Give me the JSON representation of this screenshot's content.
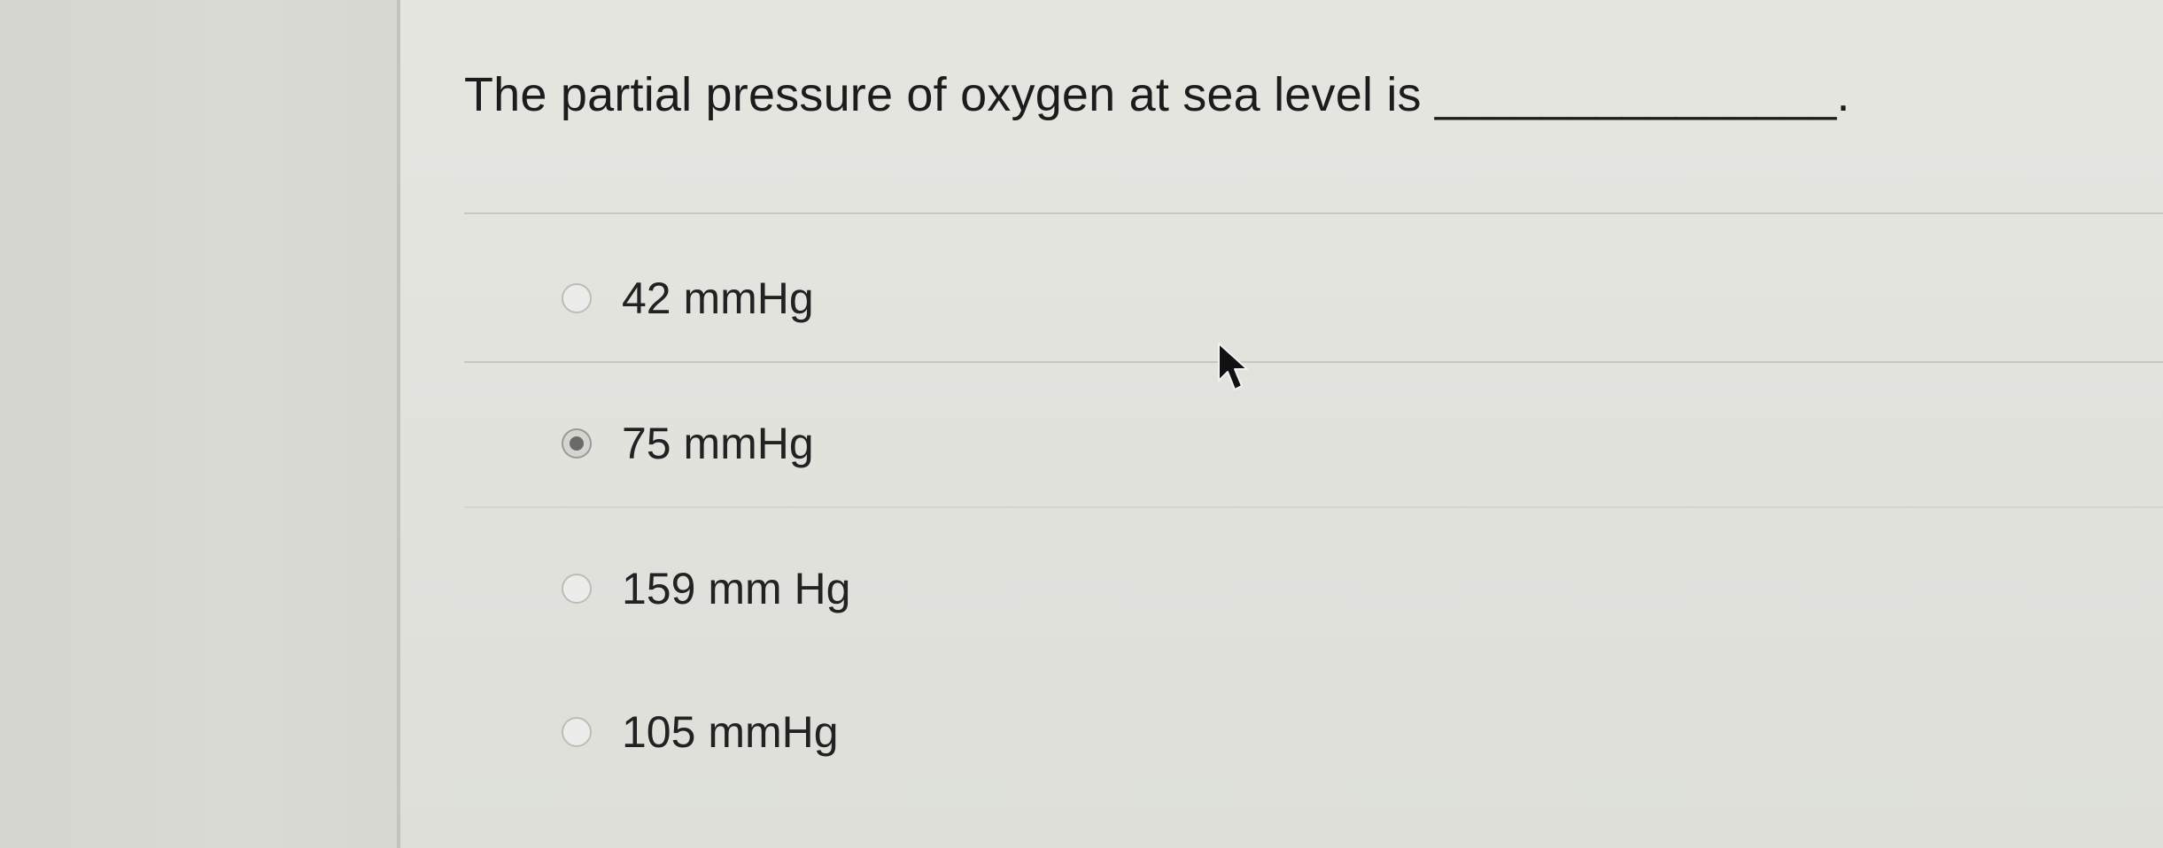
{
  "question": {
    "text": "The partial pressure of oxygen at sea level is _______________."
  },
  "options": [
    {
      "label": "42 mmHg",
      "selected": false
    },
    {
      "label": "75 mmHg",
      "selected": true
    },
    {
      "label": "159 mm Hg",
      "selected": false
    },
    {
      "label": "105 mmHg",
      "selected": false
    }
  ],
  "icons": {
    "cursor": "mouse-pointer-icon"
  }
}
